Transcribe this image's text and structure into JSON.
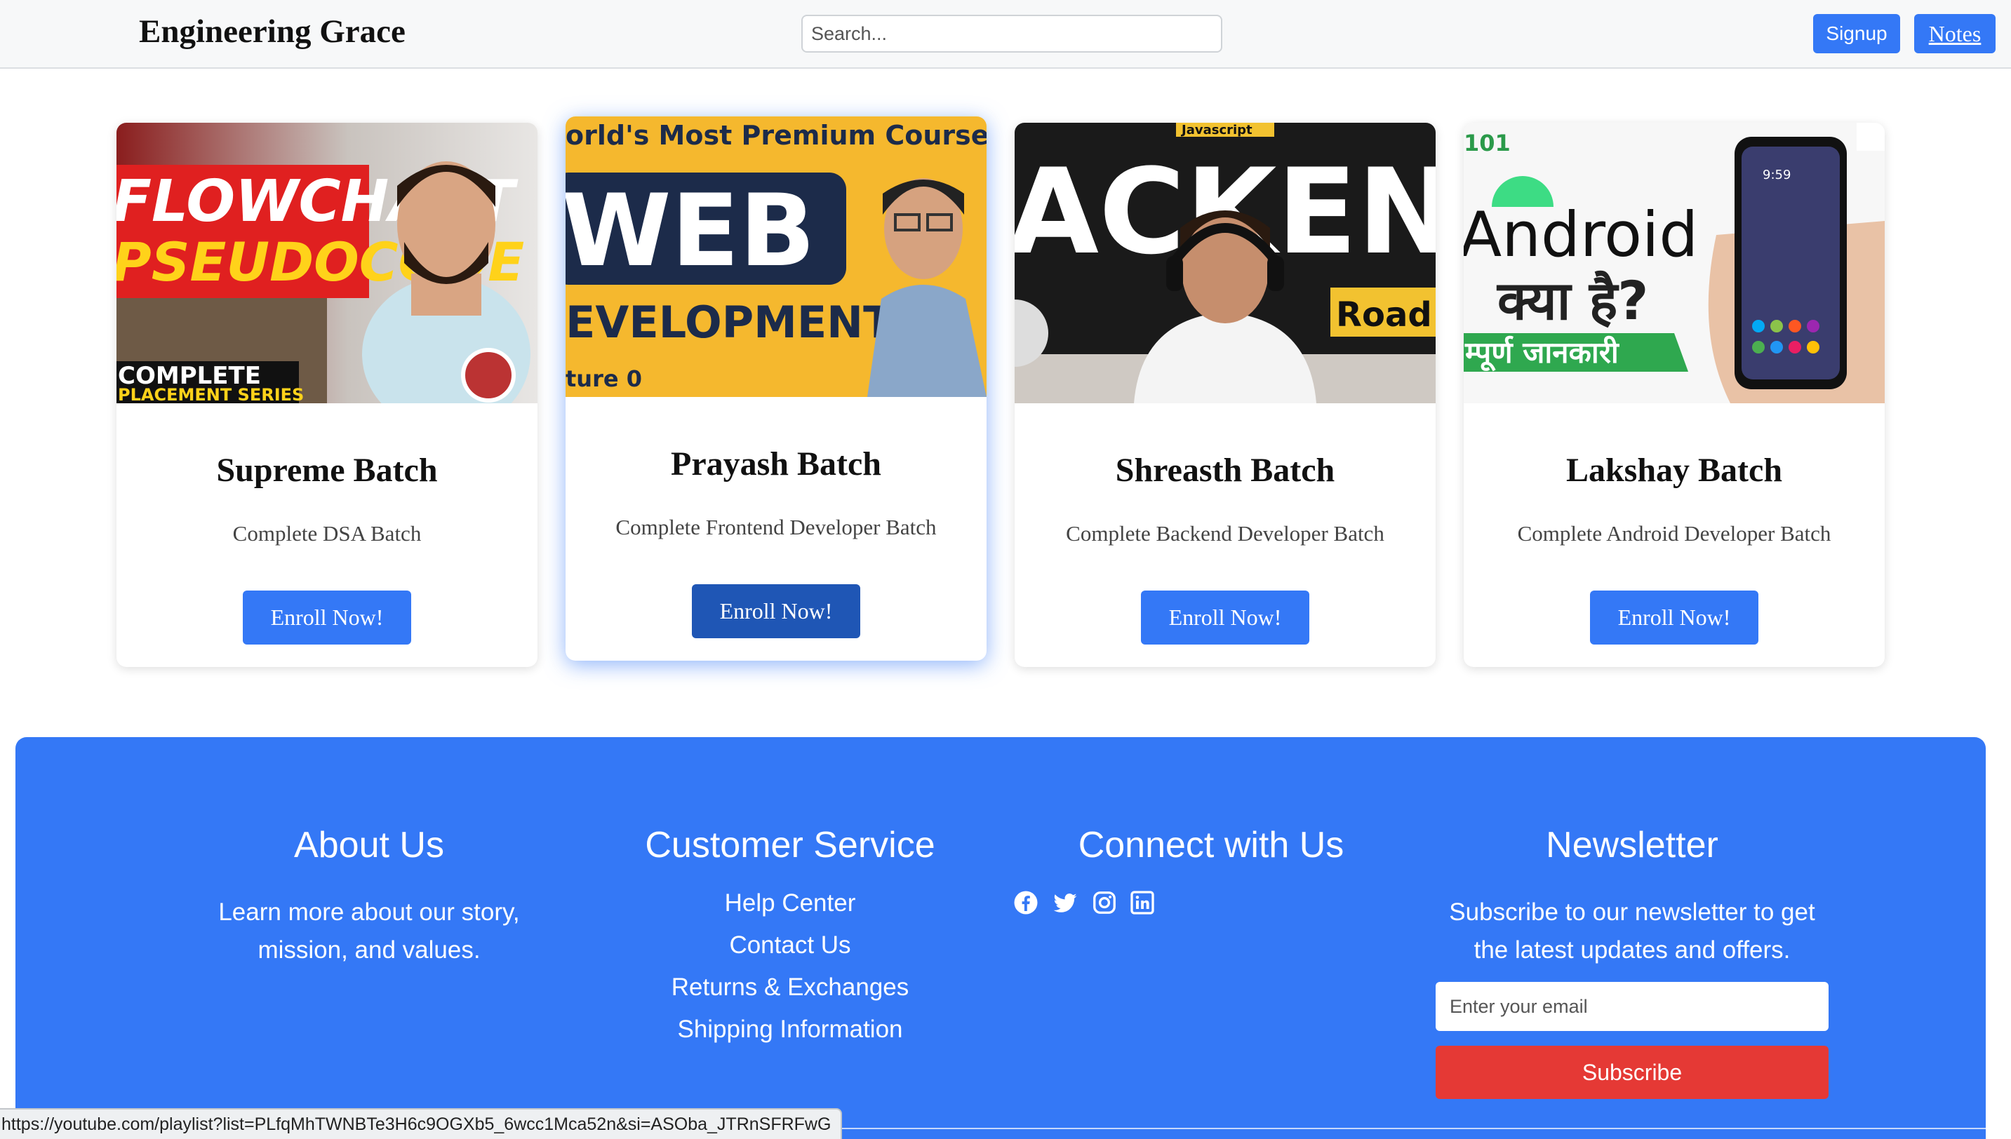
{
  "header": {
    "brand": "Engineering Grace",
    "search_placeholder": "Search...",
    "signup_label": "Signup",
    "notes_label": "Notes"
  },
  "cards": [
    {
      "title": "Supreme Batch",
      "description": "Complete DSA Batch",
      "button": "Enroll Now!",
      "thumb_text": [
        "FLOWCHART",
        "PSEUDOCODE",
        "COMPLETE",
        "PLACEMENT SERIES"
      ]
    },
    {
      "title": "Prayash Batch",
      "description": "Complete Frontend Developer Batch",
      "button": "Enroll Now!",
      "thumb_text": [
        "orld's Most Premium Course on",
        "WEB",
        "EVELOPMENT",
        "ture 0"
      ]
    },
    {
      "title": "Shreasth Batch",
      "description": "Complete Backend Developer Batch",
      "button": "Enroll Now!",
      "thumb_text": [
        "ACKEN",
        "Road",
        "Javascript"
      ]
    },
    {
      "title": "Lakshay Batch",
      "description": "Complete Android Developer Batch",
      "button": "Enroll Now!",
      "thumb_text": [
        "Android",
        "क्या है?",
        "म्पूर्ण जानकारी",
        "101",
        "9:59"
      ]
    }
  ],
  "footer": {
    "about": {
      "heading": "About Us",
      "line1": "Learn more about our story,",
      "line2": "mission, and values."
    },
    "service": {
      "heading": "Customer Service",
      "links": [
        "Help Center",
        "Contact Us",
        "Returns & Exchanges",
        "Shipping Information"
      ]
    },
    "connect": {
      "heading": "Connect with Us",
      "icons": [
        "facebook-icon",
        "twitter-icon",
        "instagram-icon",
        "linkedin-icon"
      ]
    },
    "newsletter": {
      "heading": "Newsletter",
      "line1": "Subscribe to our newsletter to get",
      "line2": "the latest updates and offers.",
      "email_placeholder": "Enter your email",
      "subscribe_label": "Subscribe"
    }
  },
  "status_url": "https://youtube.com/playlist?list=PLfqMhTWNBTe3H6c9OGXb5_6wcc1Mca52n&si=ASOba_JTRnSFRFwG",
  "colors": {
    "accent": "#3478f6",
    "accent_dark": "#1f56b5",
    "subscribe": "#e53935"
  }
}
